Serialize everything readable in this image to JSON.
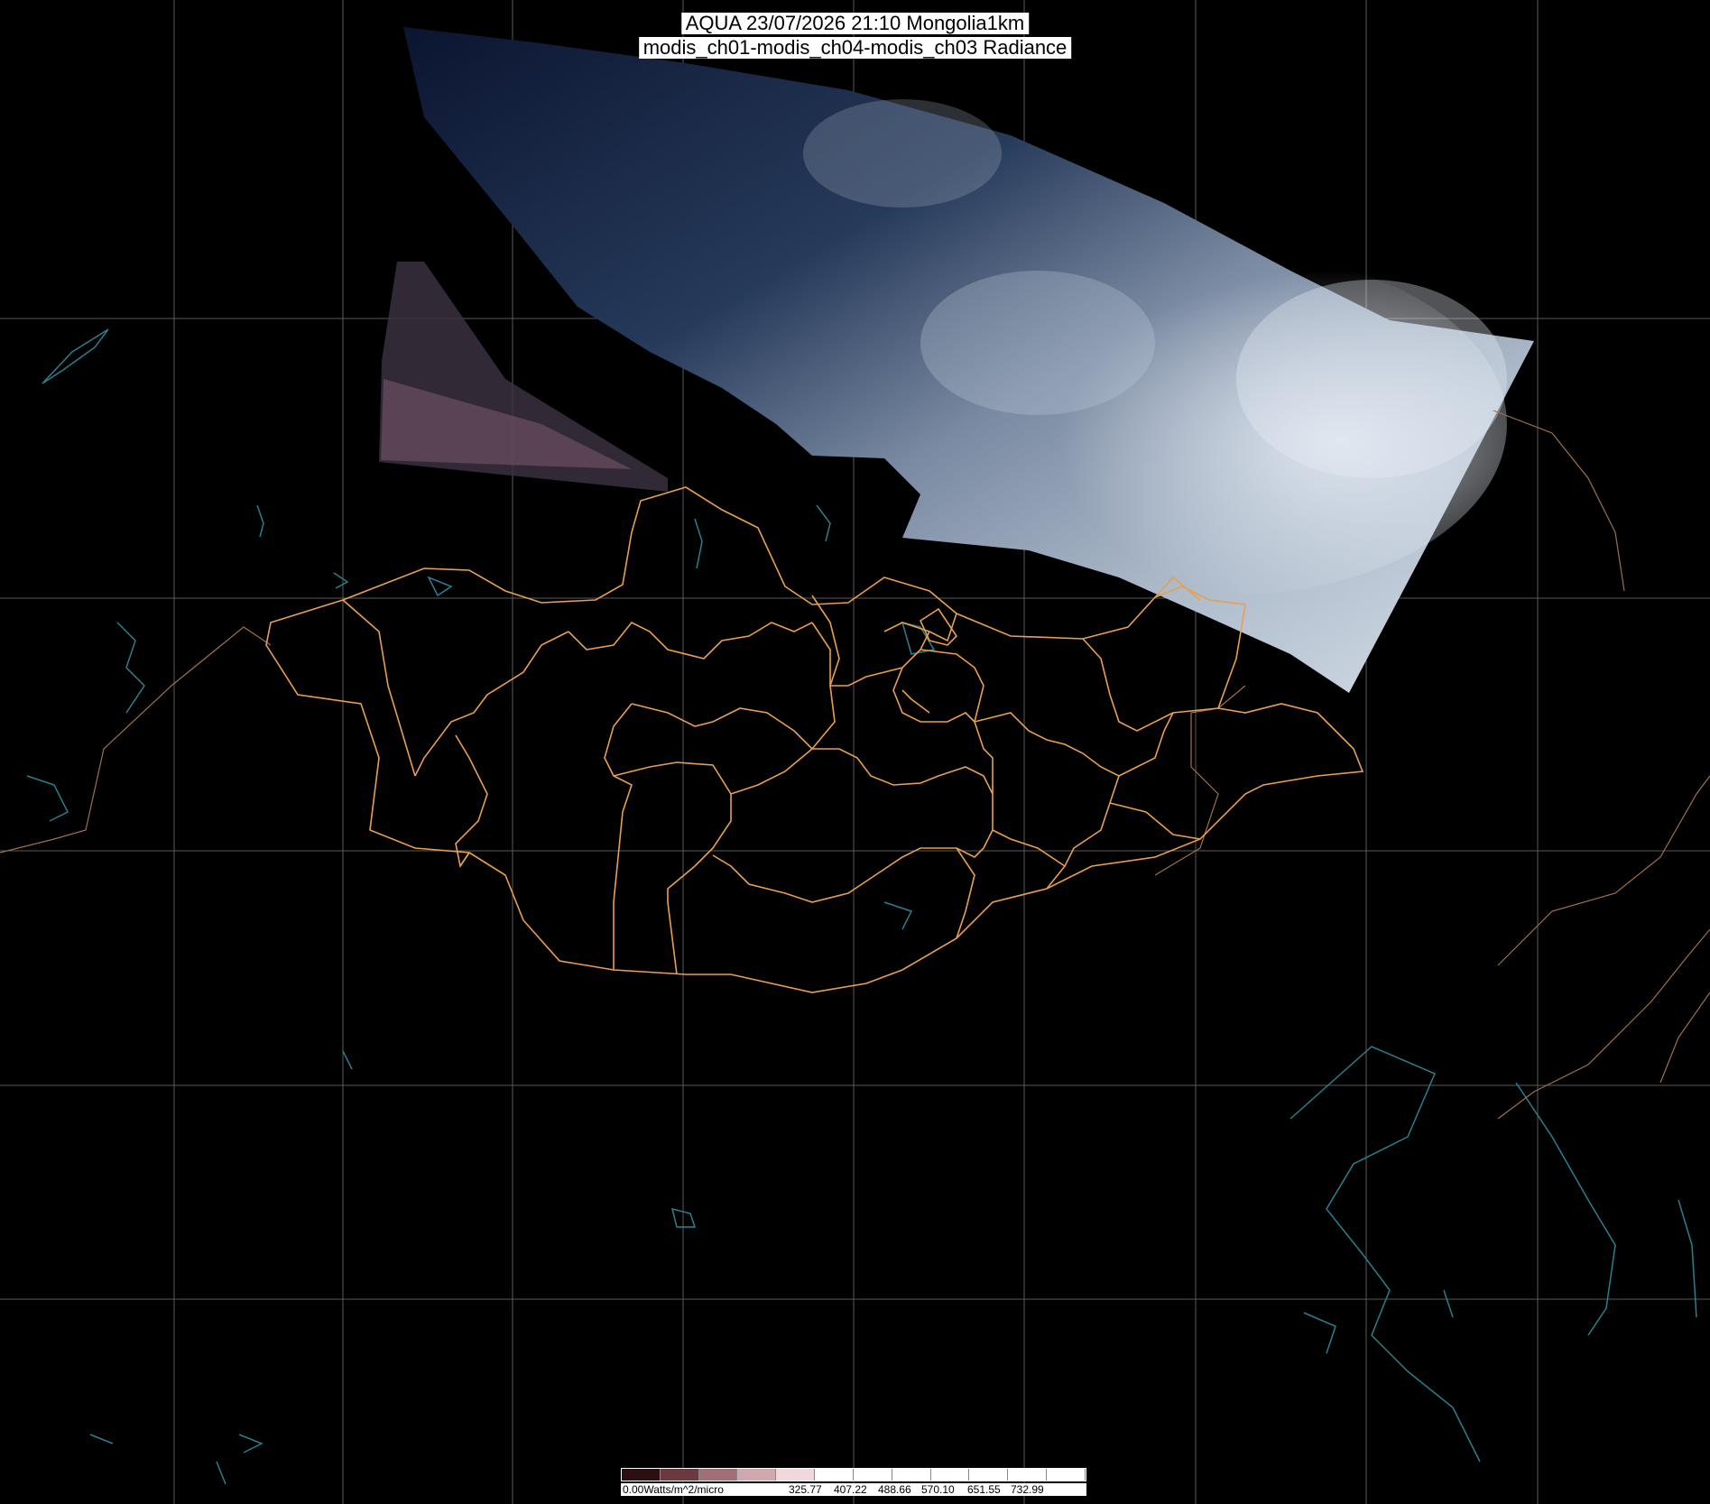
{
  "title": {
    "line1": "AQUA 23/07/2026 21:10 Mongolia1km",
    "line2": "modis_ch01-modis_ch04-modis_ch03 Radiance"
  },
  "legend": {
    "unit_label": "0.00Watts/m^2/micro",
    "tick_labels": [
      "325.77",
      "407.22",
      "488.66",
      "570.10",
      "651.55",
      "732.99"
    ],
    "colors": [
      "#2a1012",
      "#6a3a40",
      "#a07078",
      "#d0a8b0",
      "#f0d8dc",
      "#ffffff",
      "#ffffff",
      "#ffffff",
      "#ffffff",
      "#ffffff",
      "#ffffff",
      "#ffffff"
    ]
  },
  "colors": {
    "background": "#000000",
    "graticule": "#5a5a5a",
    "province_borders": "#e8a050",
    "coastlines": "#2a7f8f",
    "cloud_swath": "#c8d4e4"
  }
}
